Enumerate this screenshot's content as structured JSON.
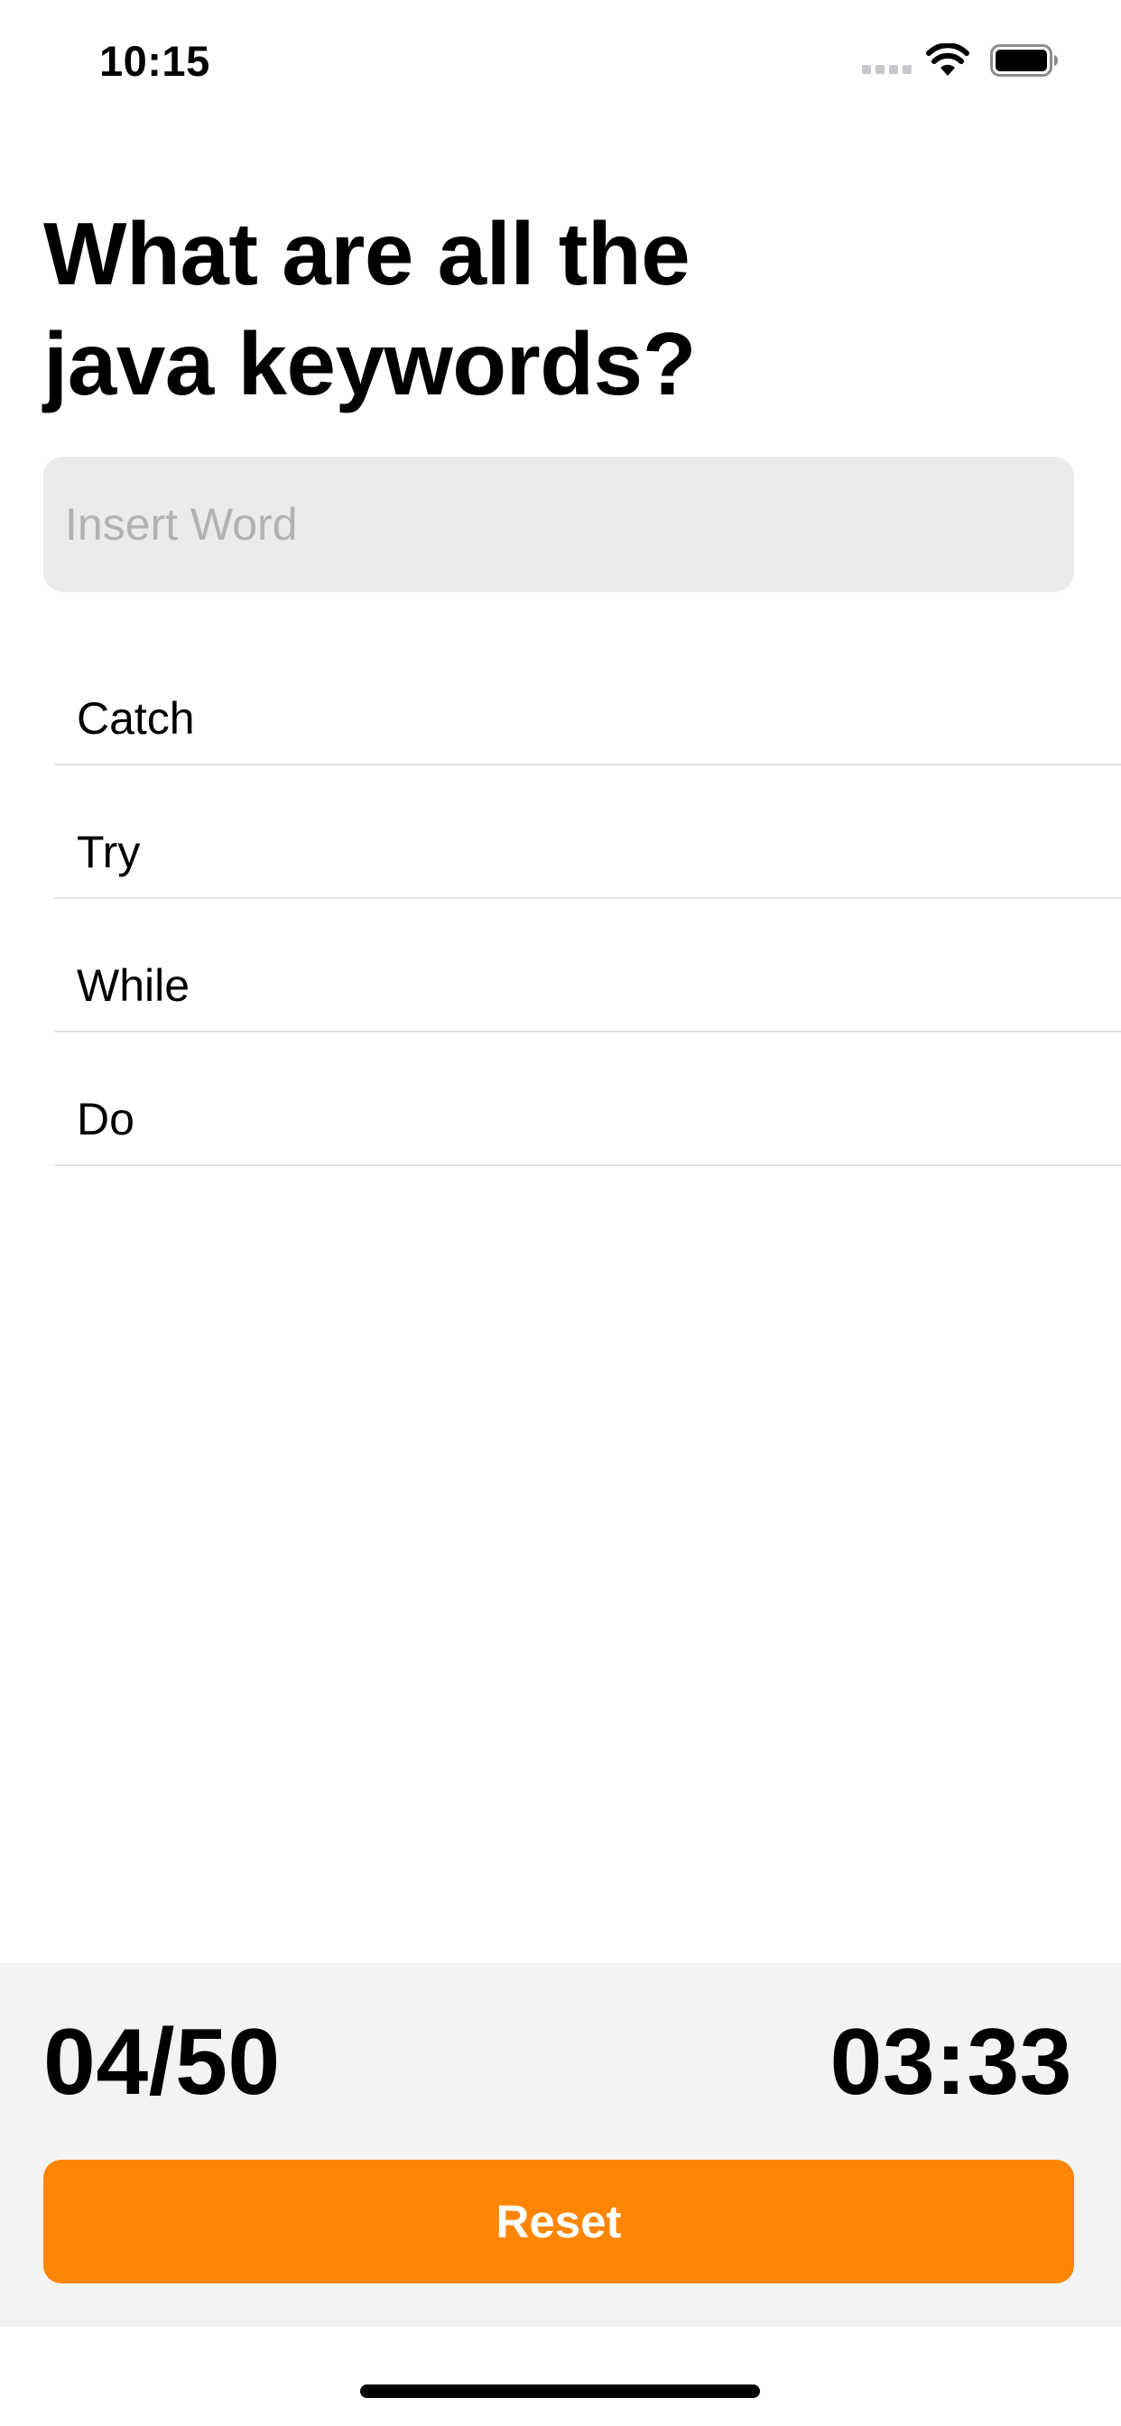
{
  "status_bar": {
    "time": "10:15",
    "icons": [
      "cellular-signal-icon",
      "wifi-icon",
      "battery-icon"
    ]
  },
  "question": {
    "line1": "What are all the",
    "line2": "java keywords?"
  },
  "input": {
    "placeholder": "Insert Word",
    "value": ""
  },
  "words": [
    "Catch",
    "Try",
    "While",
    "Do"
  ],
  "footer": {
    "count": "04/50",
    "timer": "03:33",
    "reset_label": "Reset"
  },
  "colors": {
    "accent": "#ff8504",
    "input_background": "#ebebeb",
    "panel_background": "#f3f3f3",
    "divider": "#e2e2e2",
    "placeholder": "#b2b2b2"
  }
}
